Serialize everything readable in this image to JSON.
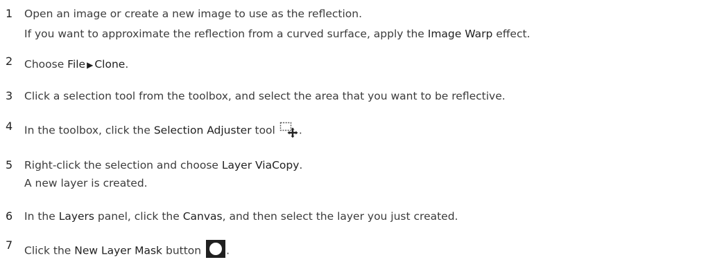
{
  "steps": [
    {
      "number": "1",
      "parts": [
        {
          "text": "Open an image or create a new image to use as the reflection.",
          "ui": false
        }
      ],
      "sub_parts": [
        {
          "text": "If you want to approximate the reflection from a curved surface, apply the ",
          "ui": false
        },
        {
          "text": "Image Warp",
          "ui": true
        },
        {
          "text": " effect.",
          "ui": false
        }
      ]
    },
    {
      "number": "2",
      "parts": [
        {
          "text": "Choose ",
          "ui": false
        },
        {
          "text": "File",
          "ui": true
        },
        {
          "text": "▶",
          "ui": true
        },
        {
          "text": "Clone",
          "ui": true
        },
        {
          "text": ".",
          "ui": false
        }
      ]
    },
    {
      "number": "3",
      "parts": [
        {
          "text": "Click a selection tool from the toolbox, and select the area that you want to be reflective.",
          "ui": false
        }
      ]
    },
    {
      "number": "4",
      "parts": [
        {
          "text": "In the toolbox, click the ",
          "ui": false
        },
        {
          "text": "Selection Adjuster",
          "ui": true
        },
        {
          "text": " tool",
          "ui": false
        }
      ],
      "icon": "selection-adjuster-icon",
      "after_icon": "."
    },
    {
      "number": "5",
      "parts": [
        {
          "text": "Right-click the selection and choose ",
          "ui": false
        },
        {
          "text": "Layer Via",
          "ui": true
        },
        {
          "text": "Copy",
          "ui": true
        },
        {
          "text": ".",
          "ui": false
        }
      ],
      "sub_parts": [
        {
          "text": "A new layer is created.",
          "ui": false
        }
      ]
    },
    {
      "number": "6",
      "parts": [
        {
          "text": "In the ",
          "ui": false
        },
        {
          "text": "Layers",
          "ui": true
        },
        {
          "text": " panel, click the ",
          "ui": false
        },
        {
          "text": "Canvas",
          "ui": true
        },
        {
          "text": ", and then select the layer you just created.",
          "ui": false
        }
      ]
    },
    {
      "number": "7",
      "parts": [
        {
          "text": "Click the ",
          "ui": false
        },
        {
          "text": "New Layer Mask",
          "ui": true
        },
        {
          "text": " button",
          "ui": false
        }
      ],
      "icon": "new-layer-mask-icon",
      "after_icon": "."
    }
  ]
}
